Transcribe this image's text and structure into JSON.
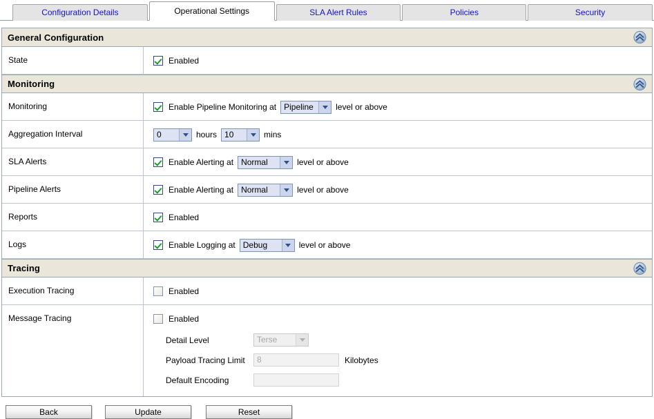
{
  "tabs": [
    {
      "label": "Configuration Details",
      "active": false
    },
    {
      "label": "Operational Settings",
      "active": true
    },
    {
      "label": "SLA Alert Rules",
      "active": false
    },
    {
      "label": "Policies",
      "active": false
    },
    {
      "label": "Security",
      "active": false
    }
  ],
  "sections": {
    "general": {
      "title": "General Configuration",
      "collapse_icon": "chevron-double-up-icon",
      "rows": {
        "state": {
          "label": "State",
          "checkbox_label": "Enabled",
          "checked": true
        }
      }
    },
    "monitoring": {
      "title": "Monitoring",
      "collapse_icon": "chevron-double-up-icon",
      "rows": {
        "monitoring": {
          "label": "Monitoring",
          "checkbox_label": "Enable Pipeline Monitoring at",
          "checked": true,
          "level_value": "Pipeline",
          "suffix": "level or above"
        },
        "aggregation_interval": {
          "label": "Aggregation Interval",
          "hours_value": "0",
          "hours_unit": "hours",
          "mins_value": "10",
          "mins_unit": "mins"
        },
        "sla_alerts": {
          "label": "SLA Alerts",
          "checkbox_label": "Enable Alerting at",
          "checked": true,
          "level_value": "Normal",
          "suffix": "level or above"
        },
        "pipeline_alerts": {
          "label": "Pipeline Alerts",
          "checkbox_label": "Enable Alerting at",
          "checked": true,
          "level_value": "Normal",
          "suffix": "level or above"
        },
        "reports": {
          "label": "Reports",
          "checkbox_label": "Enabled",
          "checked": true
        },
        "logs": {
          "label": "Logs",
          "checkbox_label": "Enable Logging at",
          "checked": true,
          "level_value": "Debug",
          "suffix": "level or above"
        }
      }
    },
    "tracing": {
      "title": "Tracing",
      "collapse_icon": "chevron-double-up-icon",
      "rows": {
        "execution_tracing": {
          "label": "Execution Tracing",
          "checkbox_label": "Enabled",
          "checked": false
        },
        "message_tracing": {
          "label": "Message Tracing",
          "checkbox_label": "Enabled",
          "checked": false,
          "detail_level_label": "Detail Level",
          "detail_level_value": "Terse",
          "payload_limit_label": "Payload Tracing Limit",
          "payload_limit_value": "8",
          "payload_limit_unit": "Kilobytes",
          "default_encoding_label": "Default Encoding",
          "default_encoding_value": ""
        }
      }
    }
  },
  "footer": {
    "back_label": "Back",
    "update_label": "Update",
    "reset_label": "Reset"
  }
}
